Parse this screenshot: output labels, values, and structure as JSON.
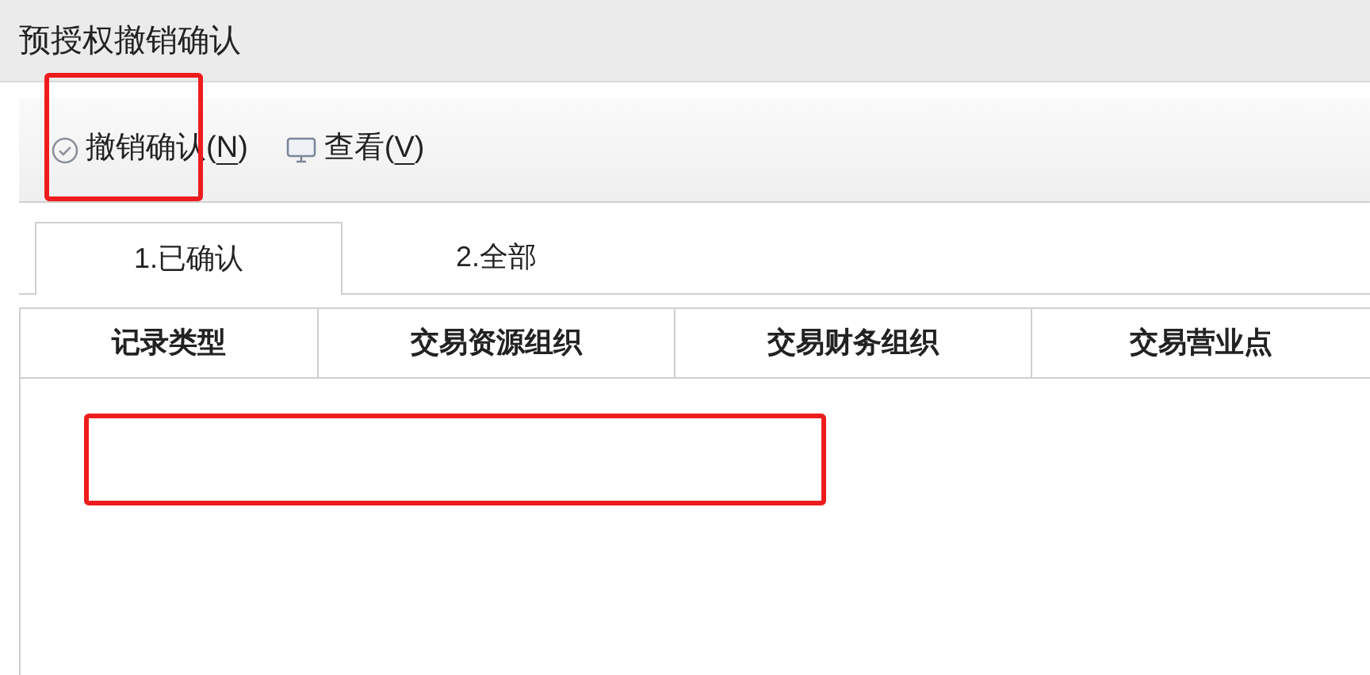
{
  "window": {
    "title": "预授权撤销确认"
  },
  "toolbar": {
    "buttons": [
      {
        "kind": "confirm",
        "label": "撤销确认(",
        "key": "N",
        "tail": ")",
        "highlighted": true
      },
      {
        "kind": "view",
        "label": "查看(",
        "key": "V",
        "tail": ")",
        "highlighted": false
      }
    ]
  },
  "tabs": [
    {
      "label": "1.已确认",
      "selected": true
    },
    {
      "label": "2.全部",
      "selected": false
    }
  ],
  "table": {
    "columns": [
      "记录类型",
      "交易资源组织",
      "交易财务组织",
      "交易营业点"
    ],
    "empty_row_highlighted": true
  }
}
